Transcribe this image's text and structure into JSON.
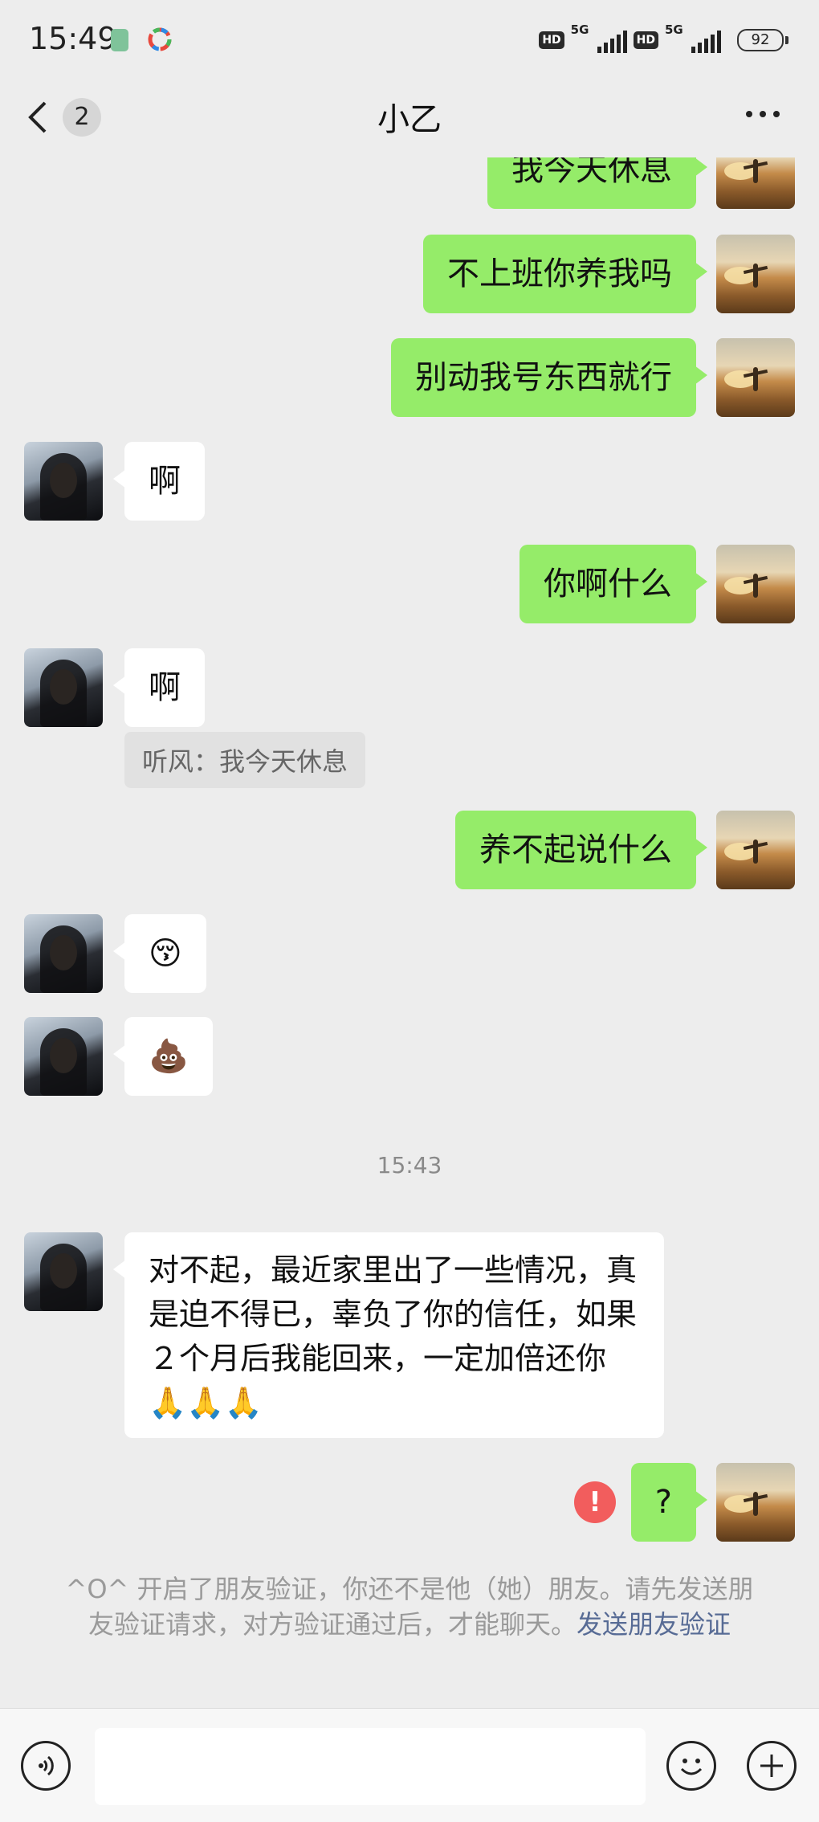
{
  "status_bar": {
    "time": "15:49",
    "hd1": "HD",
    "net1": "5G",
    "hd2": "HD",
    "net2": "5G",
    "battery": "92"
  },
  "header": {
    "unread_count": "2",
    "title": "小乙",
    "back_icon": "chevron-left-icon",
    "more_icon": "more-dots-icon"
  },
  "messages": [
    {
      "from": "me",
      "text": "我今天休息"
    },
    {
      "from": "me",
      "text": "不上班你养我吗"
    },
    {
      "from": "me",
      "text": "别动我号东西就行"
    },
    {
      "from": "other",
      "text": "啊"
    },
    {
      "from": "me",
      "text": "你啊什么"
    },
    {
      "from": "other",
      "text": "啊",
      "quote": "听风：我今天休息"
    },
    {
      "from": "me",
      "text": "养不起说什么"
    },
    {
      "from": "other",
      "text": "😚"
    },
    {
      "from": "other",
      "text": "💩"
    },
    {
      "type": "time",
      "text": "15:43"
    },
    {
      "from": "other",
      "text": "对不起，最近家里出了一些情况，真是迫不得已，辜负了你的信任，如果２个月后我能回来，一定加倍还你🙏🙏🙏"
    },
    {
      "from": "me",
      "text": "?",
      "status": "failed",
      "status_glyph": "!"
    }
  ],
  "system_notice": {
    "text": "^O^ 开启了朋友验证，你还不是他（她）朋友。请先发送朋友验证请求，对方验证通过后，才能聊天。",
    "link": "发送朋友验证"
  },
  "input_bar": {
    "voice_icon": "voice-icon",
    "placeholder": "",
    "emoji_icon": "emoji-icon",
    "plus_icon": "plus-icon"
  },
  "colors": {
    "background": "#ededed",
    "my_bubble": "#95ec69",
    "their_bubble": "#ffffff",
    "link": "#576b95",
    "error": "#f25d5d"
  }
}
